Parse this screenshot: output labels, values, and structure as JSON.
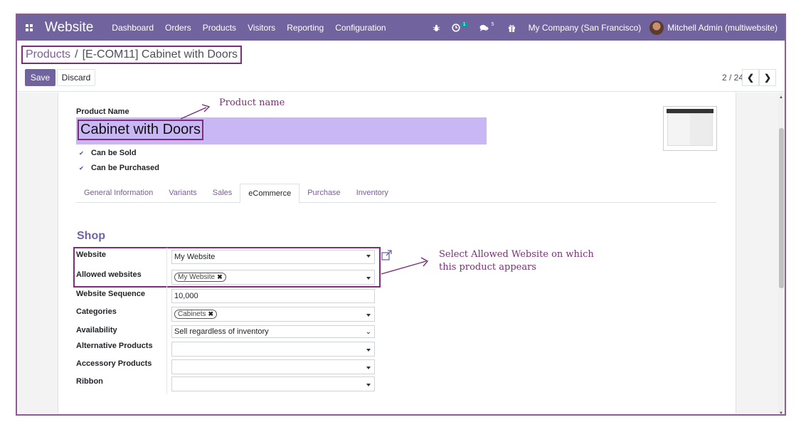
{
  "navbar": {
    "brand": "Website",
    "menu": [
      "Dashboard",
      "Orders",
      "Products",
      "Visitors",
      "Reporting",
      "Configuration"
    ],
    "activity_count": "1",
    "messages_count": "5",
    "company": "My Company (San Francisco)",
    "user": "Mitchell Admin (multiwebsite)"
  },
  "breadcrumb": {
    "parent": "Products",
    "separator": "/",
    "current": "[E-COM11] Cabinet with Doors"
  },
  "buttons": {
    "save": "Save",
    "discard": "Discard"
  },
  "pager": {
    "value": "2 / 24"
  },
  "form": {
    "product_name_label": "Product Name",
    "product_name": "Cabinet with Doors",
    "can_be_sold": "Can be Sold",
    "can_be_purchased": "Can be Purchased",
    "tabs": [
      "General Information",
      "Variants",
      "Sales",
      "eCommerce",
      "Purchase",
      "Inventory"
    ],
    "active_tab": "eCommerce",
    "section_title": "Shop",
    "fields": {
      "website_label": "Website",
      "website_value": "My Website",
      "allowed_websites_label": "Allowed websites",
      "allowed_websites_tag": "My Website",
      "website_sequence_label": "Website Sequence",
      "website_sequence_value": "10,000",
      "categories_label": "Categories",
      "categories_tag": "Cabinets",
      "availability_label": "Availability",
      "availability_value": "Sell regardless of inventory",
      "alternative_products_label": "Alternative Products",
      "accessory_products_label": "Accessory Products",
      "ribbon_label": "Ribbon"
    }
  },
  "annotations": {
    "product_name": "Product name",
    "allowed_line1": "Select Allowed Website on which",
    "allowed_line2": "this product appears"
  },
  "colors": {
    "navbar": "#71639e",
    "annotation": "#7a2f78",
    "name_highlight": "#c8b6f5"
  }
}
